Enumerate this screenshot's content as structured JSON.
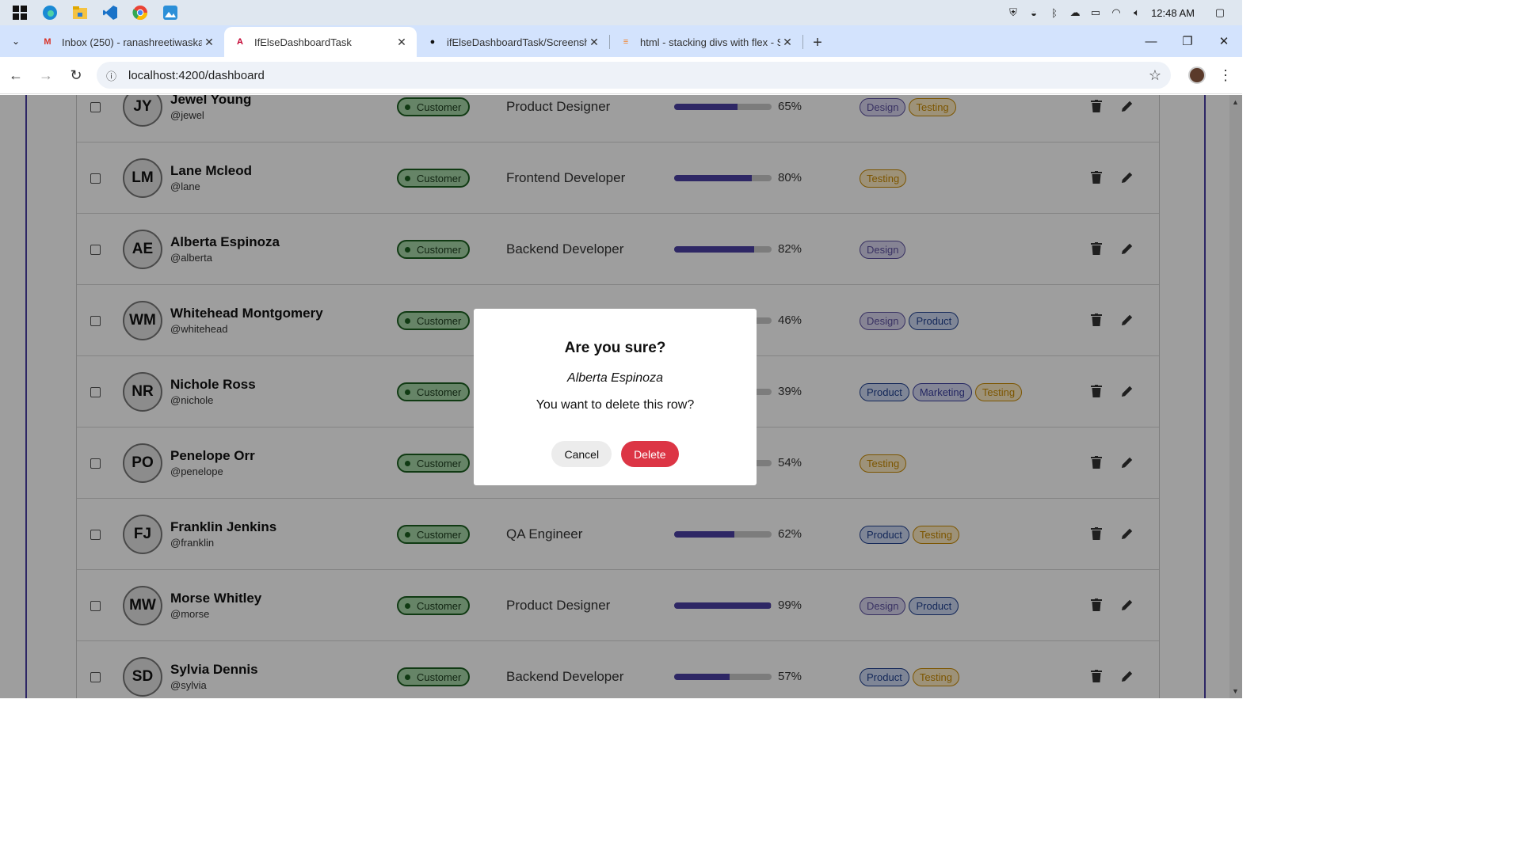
{
  "taskbar": {
    "apps": [
      "windows-start-icon",
      "edge-icon",
      "file-explorer-icon",
      "vscode-icon",
      "chrome-icon",
      "photos-icon"
    ],
    "time": "12:48 AM"
  },
  "tabs": [
    {
      "title": "Inbox (250) - ranashreetiwaskar",
      "favicon": "M",
      "color": "#d93025"
    },
    {
      "title": "IfElseDashboardTask",
      "favicon": "A",
      "color": "#c3002f"
    },
    {
      "title": "ifElseDashboardTask/Screensho",
      "favicon": "●",
      "color": "#111111"
    },
    {
      "title": "html - stacking divs with flex - S",
      "favicon": "≡",
      "color": "#f48024"
    }
  ],
  "address": {
    "url": "localhost:4200/dashboard"
  },
  "rows": [
    {
      "initials": "JY",
      "name": "Jewel Young",
      "handle": "@jewel",
      "role": "Customer",
      "job": "Product Designer",
      "progress": 65,
      "pct": "65%",
      "tags": [
        {
          "label": "Design",
          "kind": "design"
        },
        {
          "label": "Testing",
          "kind": "testing"
        }
      ]
    },
    {
      "initials": "LM",
      "name": "Lane Mcleod",
      "handle": "@lane",
      "role": "Customer",
      "job": "Frontend Developer",
      "progress": 80,
      "pct": "80%",
      "tags": [
        {
          "label": "Testing",
          "kind": "testing"
        }
      ]
    },
    {
      "initials": "AE",
      "name": "Alberta Espinoza",
      "handle": "@alberta",
      "role": "Customer",
      "job": "Backend Developer",
      "progress": 82,
      "pct": "82%",
      "tags": [
        {
          "label": "Design",
          "kind": "design"
        }
      ]
    },
    {
      "initials": "WM",
      "name": "Whitehead Montgomery",
      "handle": "@whitehead",
      "role": "Customer",
      "job": "",
      "progress": 46,
      "pct": "46%",
      "tags": [
        {
          "label": "Design",
          "kind": "design"
        },
        {
          "label": "Product",
          "kind": "product"
        }
      ]
    },
    {
      "initials": "NR",
      "name": "Nichole Ross",
      "handle": "@nichole",
      "role": "Customer",
      "job": "",
      "progress": 39,
      "pct": "39%",
      "tags": [
        {
          "label": "Product",
          "kind": "product"
        },
        {
          "label": "Marketing",
          "kind": "marketing"
        },
        {
          "label": "Testing",
          "kind": "testing"
        }
      ]
    },
    {
      "initials": "PO",
      "name": "Penelope Orr",
      "handle": "@penelope",
      "role": "Customer",
      "job": "",
      "progress": 54,
      "pct": "54%",
      "tags": [
        {
          "label": "Testing",
          "kind": "testing"
        }
      ]
    },
    {
      "initials": "FJ",
      "name": "Franklin Jenkins",
      "handle": "@franklin",
      "role": "Customer",
      "job": "QA Engineer",
      "progress": 62,
      "pct": "62%",
      "tags": [
        {
          "label": "Product",
          "kind": "product"
        },
        {
          "label": "Testing",
          "kind": "testing"
        }
      ]
    },
    {
      "initials": "MW",
      "name": "Morse Whitley",
      "handle": "@morse",
      "role": "Customer",
      "job": "Product Designer",
      "progress": 99,
      "pct": "99%",
      "tags": [
        {
          "label": "Design",
          "kind": "design"
        },
        {
          "label": "Product",
          "kind": "product"
        }
      ]
    },
    {
      "initials": "SD",
      "name": "Sylvia Dennis",
      "handle": "@sylvia",
      "role": "Customer",
      "job": "Backend Developer",
      "progress": 57,
      "pct": "57%",
      "tags": [
        {
          "label": "Product",
          "kind": "product"
        },
        {
          "label": "Testing",
          "kind": "testing"
        }
      ]
    }
  ],
  "modal": {
    "title": "Are you sure?",
    "target_name": "Alberta Espinoza",
    "message": "You want to delete this row?",
    "cancel_label": "Cancel",
    "delete_label": "Delete"
  },
  "colors": {
    "accent": "#4b3fa3",
    "danger": "#dc3545",
    "customer_badge": "#a5d6a7"
  }
}
